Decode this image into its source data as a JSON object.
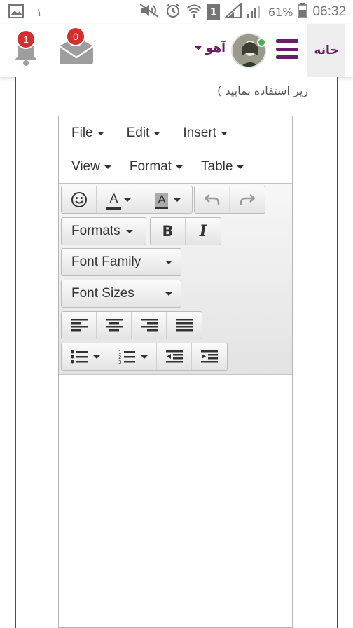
{
  "status_bar": {
    "left_number": "١",
    "battery_percent": "61%",
    "time": "06:32",
    "sim_indicator": "1",
    "icons": [
      "image-icon",
      "mute-icon",
      "alarm-icon",
      "wifi-icon",
      "signal-icon",
      "signal-icon",
      "battery-icon"
    ]
  },
  "app_bar": {
    "home_label": "خانه",
    "username": "آهو",
    "mail_badge": "0",
    "notifications_badge": "1",
    "accent_color": "#6a1b6a",
    "badge_color": "#d32f2f"
  },
  "content": {
    "description": "زیر استفاده نمایید )"
  },
  "editor": {
    "menus": {
      "file": "File",
      "edit": "Edit",
      "insert": "Insert",
      "view": "View",
      "format": "Format",
      "table": "Table"
    },
    "toolbar": {
      "formats": "Formats",
      "font_family": "Font Family",
      "font_sizes": "Font Sizes",
      "text_color_glyph": "A",
      "bg_color_glyph": "A",
      "bold_glyph": "B",
      "italic_glyph": "I"
    }
  }
}
